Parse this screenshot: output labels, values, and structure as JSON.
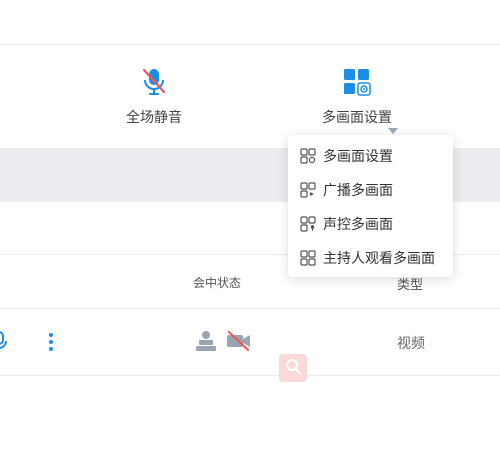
{
  "toolbar": {
    "mute_all_label": "全场静音",
    "layout_settings_label": "多画面设置"
  },
  "layout_menu": {
    "items": [
      {
        "label": "多画面设置",
        "icon": "layout-settings-icon"
      },
      {
        "label": "广播多画面",
        "icon": "broadcast-layout-icon"
      },
      {
        "label": "声控多画面",
        "icon": "voice-layout-icon"
      },
      {
        "label": "主持人观看多画面",
        "icon": "host-view-layout-icon"
      }
    ]
  },
  "table": {
    "headers": {
      "status": "会中状态",
      "type": "类型"
    },
    "rows": [
      {
        "type": "视频"
      }
    ]
  },
  "colors": {
    "accent": "#1a8fe3",
    "mute_slash": "#f05656",
    "band": "#ebedf1",
    "search_fab": "#fbd9d9"
  }
}
